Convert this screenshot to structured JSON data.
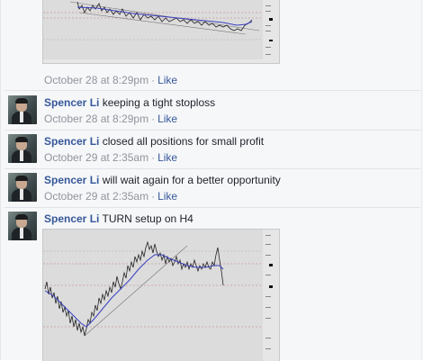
{
  "top_image": {
    "meta": {
      "timestamp": "October 28 at 8:29pm",
      "separator": "·",
      "like": "Like"
    }
  },
  "comments": [
    {
      "author": "Spencer Li",
      "text": "keeping a tight stoploss",
      "timestamp": "October 28 at 8:29pm",
      "separator": "·",
      "like": "Like"
    },
    {
      "author": "Spencer Li",
      "text": "closed all positions for small profit",
      "timestamp": "October 29 at 2:35am",
      "separator": "·",
      "like": "Like"
    },
    {
      "author": "Spencer Li",
      "text": "will wait again for a better opportunity",
      "timestamp": "October 29 at 2:35am",
      "separator": "·",
      "like": "Like"
    },
    {
      "author": "Spencer Li",
      "text": "TURN setup on H4"
    }
  ],
  "colors": {
    "link": "#365899",
    "meta": "#90949c",
    "chart_bg": "#dcdcdc",
    "moving_average": "#3a3fbf",
    "horizontal_levels": "#d07070"
  }
}
